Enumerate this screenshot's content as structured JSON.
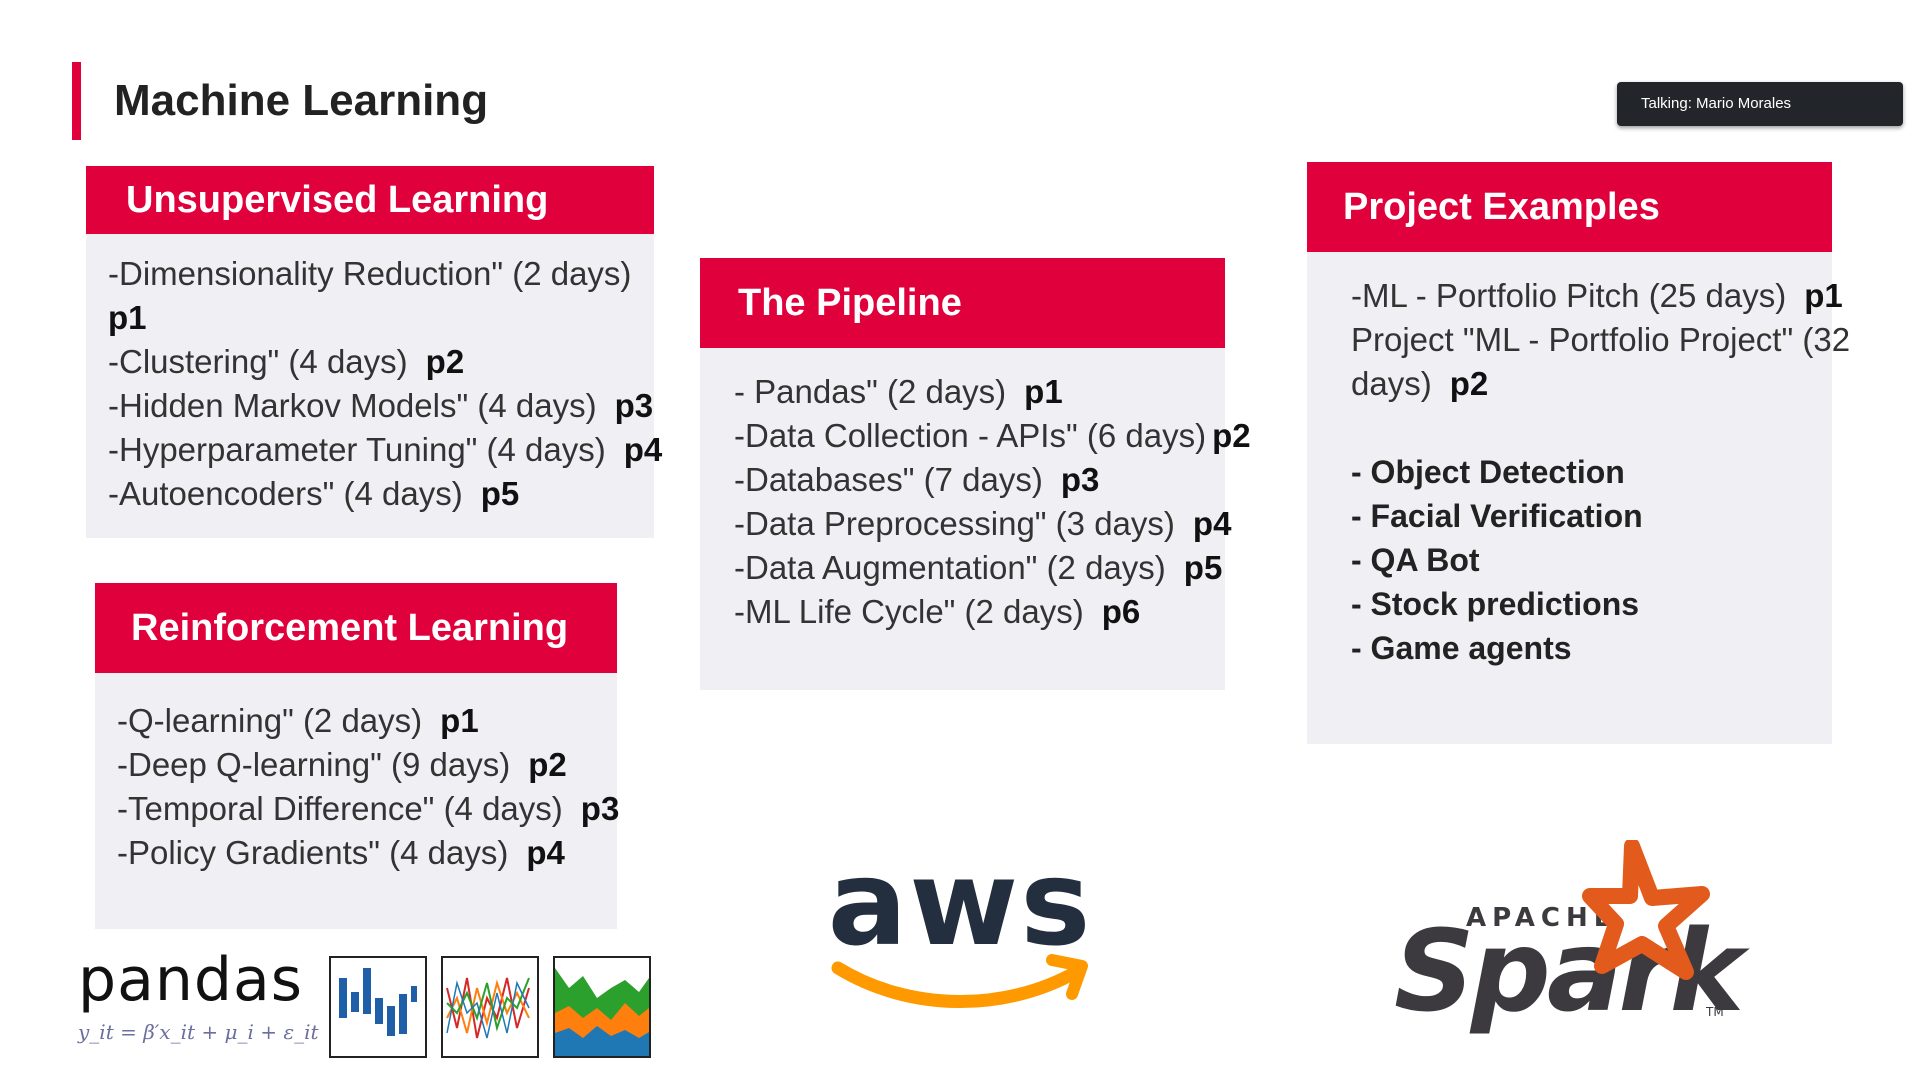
{
  "slide": {
    "title": "Machine Learning",
    "talking": "Talking: Mario Morales"
  },
  "unsupervised": {
    "title": "Unsupervised Learning",
    "items": [
      {
        "text": "-Dimensionality Reduction\" (2 days)",
        "priority": "p1"
      },
      {
        "text": "-Clustering\" (4 days)",
        "priority": "p2"
      },
      {
        "text": "-Hidden Markov Models\" (4 days)",
        "priority": "p3"
      },
      {
        "text": "-Hyperparameter Tuning\" (4 days)",
        "priority": "p4"
      },
      {
        "text": "-Autoencoders\" (4 days)",
        "priority": "p5"
      }
    ]
  },
  "reinforcement": {
    "title": "Reinforcement Learning",
    "items": [
      {
        "text": "-Q-learning\" (2 days)",
        "priority": "p1"
      },
      {
        "text": "-Deep Q-learning\" (9 days)",
        "priority": "p2"
      },
      {
        "text": "-Temporal Difference\" (4 days)",
        "priority": "p3"
      },
      {
        "text": "-Policy Gradients\" (4 days)",
        "priority": "p4"
      }
    ]
  },
  "pipeline": {
    "title": "The Pipeline",
    "items": [
      {
        "text": "- Pandas\" (2 days)",
        "priority": "p1"
      },
      {
        "text": "-Data Collection - APIs\" (6 days)",
        "priority": "p2"
      },
      {
        "text": "-Databases\" (7 days)",
        "priority": "p3"
      },
      {
        "text": "-Data Preprocessing\" (3 days)",
        "priority": "p4"
      },
      {
        "text": "-Data Augmentation\" (2 days)",
        "priority": "p5"
      },
      {
        "text": "-ML Life Cycle\" (2 days)",
        "priority": "p6"
      }
    ]
  },
  "projects": {
    "title": "Project Examples",
    "pitch": {
      "text": "-ML - Portfolio Pitch (25 days)",
      "priority": "p1"
    },
    "project_line1": "Project \"ML - Portfolio Project\" (32",
    "project_line2": "days)",
    "project_priority": "p2",
    "examples": [
      "- Object Detection",
      "- Facial Verification",
      "- QA Bot",
      "- Stock predictions",
      "- Game agents"
    ]
  },
  "logos": {
    "pandas_word": "pandas",
    "pandas_formula": "y_it = β′x_it + μ_i + ε_it",
    "aws_word": "aws",
    "spark_apache": "APACHE",
    "spark_word": "Spark",
    "spark_tm": "TM"
  },
  "colors": {
    "accent": "#e0003b",
    "card_bg": "#f0eff3",
    "aws_text": "#232f3e",
    "aws_smile": "#ff9900",
    "spark_text": "#3c3a3e",
    "spark_star": "#e25a1c"
  }
}
